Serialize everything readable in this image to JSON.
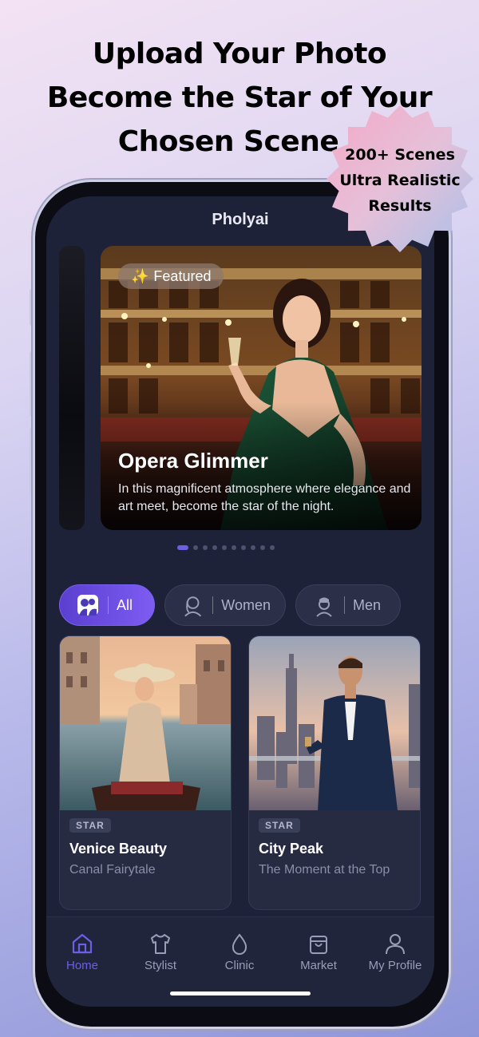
{
  "promo": {
    "headline_line1": "Upload Your Photo",
    "headline_line2": "Become the Star of Your",
    "headline_line3": "Chosen Scene",
    "badge_line1": "200+ Scenes",
    "badge_line2": "Ultra Realistic",
    "badge_line3": "Results"
  },
  "app": {
    "title": "Pholyai"
  },
  "hero": {
    "badge_icon": "sparkles-icon",
    "badge_icon_glyph": "✨",
    "badge_label": "Featured",
    "title": "Opera Glimmer",
    "description": "In this magnificent atmosphere where elegance and art meet, become the star of the night.",
    "page_count": 10,
    "active_page": 1
  },
  "filters": [
    {
      "label": "All",
      "icon": "couple-silhouette-icon",
      "active": true
    },
    {
      "label": "Women",
      "icon": "woman-silhouette-icon",
      "active": false
    },
    {
      "label": "Men",
      "icon": "man-silhouette-icon",
      "active": false
    }
  ],
  "cards": [
    {
      "tag": "STAR",
      "title": "Venice Beauty",
      "subtitle": "Canal Fairytale"
    },
    {
      "tag": "STAR",
      "title": "City Peak",
      "subtitle": "The Moment at the Top"
    }
  ],
  "tabs": [
    {
      "label": "Home",
      "icon": "home-icon",
      "active": true
    },
    {
      "label": "Stylist",
      "icon": "tshirt-icon",
      "active": false
    },
    {
      "label": "Clinic",
      "icon": "droplet-icon",
      "active": false
    },
    {
      "label": "Market",
      "icon": "shopping-bag-icon",
      "active": false
    },
    {
      "label": "My Profile",
      "icon": "user-icon",
      "active": false
    }
  ],
  "colors": {
    "accent": "#6d5ee6",
    "screen_bg": "#1d2238",
    "card_bg": "#262b42"
  }
}
